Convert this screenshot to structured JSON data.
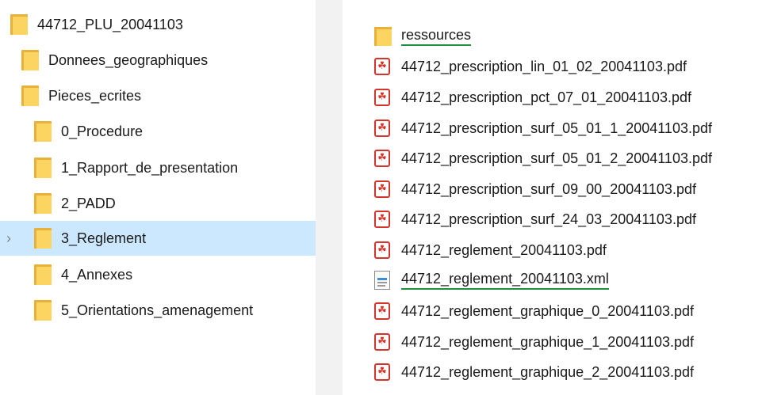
{
  "tree": {
    "items": [
      {
        "label": "44712_PLU_20041103",
        "icon": "folder-icon"
      },
      {
        "label": "Donnees_geographiques",
        "icon": "folder-icon"
      },
      {
        "label": "Pieces_ecrites",
        "icon": "folder-icon"
      },
      {
        "label": "0_Procedure",
        "icon": "folder-icon"
      },
      {
        "label": "1_Rapport_de_presentation",
        "icon": "folder-icon"
      },
      {
        "label": "2_PADD",
        "icon": "folder-icon"
      },
      {
        "label": "3_Reglement",
        "icon": "folder-icon",
        "selected": true,
        "chevron": "›"
      },
      {
        "label": "4_Annexes",
        "icon": "folder-icon"
      },
      {
        "label": "5_Orientations_amenagement",
        "icon": "folder-icon"
      }
    ]
  },
  "files": {
    "items": [
      {
        "name": "ressources",
        "icon": "folder-icon"
      },
      {
        "name": "44712_prescription_lin_01_02_20041103.pdf",
        "icon": "pdf-icon",
        "glyph": "☘"
      },
      {
        "name": "44712_prescription_pct_07_01_20041103.pdf",
        "icon": "pdf-icon",
        "glyph": "☘"
      },
      {
        "name": "44712_prescription_surf_05_01_1_20041103.pdf",
        "icon": "pdf-icon",
        "glyph": "☘"
      },
      {
        "name": "44712_prescription_surf_05_01_2_20041103.pdf",
        "icon": "pdf-icon",
        "glyph": "☘"
      },
      {
        "name": "44712_prescription_surf_09_00_20041103.pdf",
        "icon": "pdf-icon",
        "glyph": "☘"
      },
      {
        "name": "44712_prescription_surf_24_03_20041103.pdf",
        "icon": "pdf-icon",
        "glyph": "☘"
      },
      {
        "name": "44712_reglement_20041103.pdf",
        "icon": "pdf-icon",
        "glyph": "☘"
      },
      {
        "name": "44712_reglement_20041103.xml",
        "icon": "xml-file-icon"
      },
      {
        "name": "44712_reglement_graphique_0_20041103.pdf",
        "icon": "pdf-icon",
        "glyph": "☘"
      },
      {
        "name": "44712_reglement_graphique_1_20041103.pdf",
        "icon": "pdf-icon",
        "glyph": "☘"
      },
      {
        "name": "44712_reglement_graphique_2_20041103.pdf",
        "icon": "pdf-icon",
        "glyph": "☘"
      }
    ]
  },
  "colors": {
    "selection": "#cce8ff",
    "folder_front": "#fcd462",
    "folder_back": "#e8b23a",
    "pdf_red": "#d4342a",
    "underline_green": "#1f8f3f"
  }
}
